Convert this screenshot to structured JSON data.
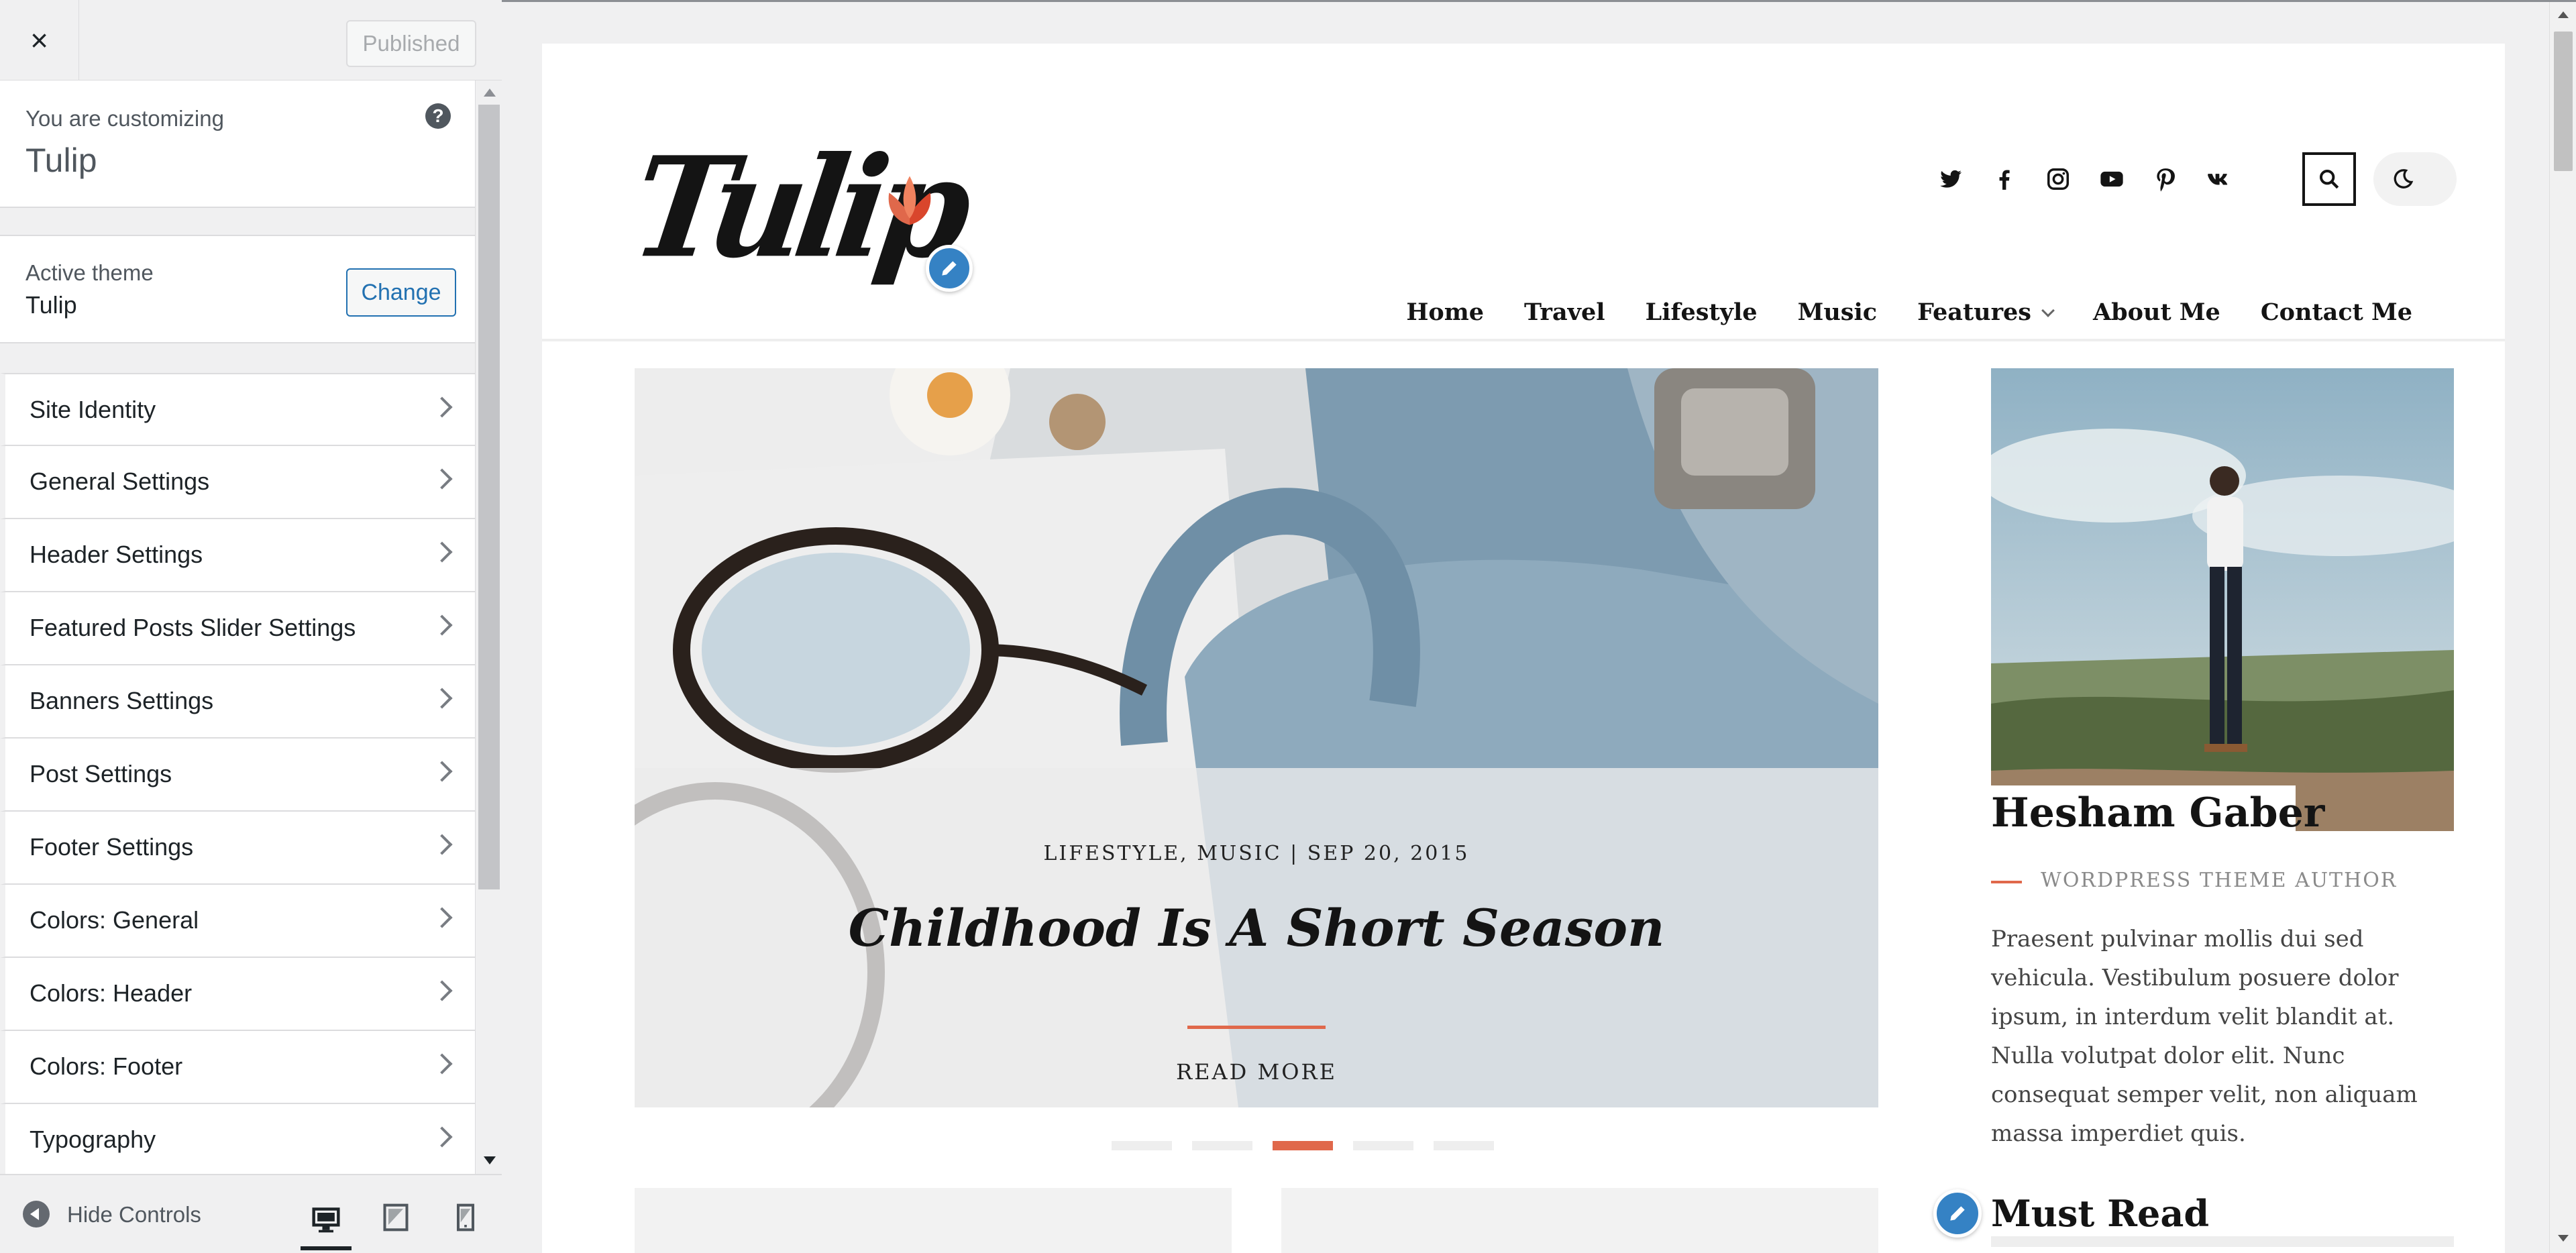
{
  "customizer": {
    "close_label": "×",
    "publish_label": "Published",
    "info_pre": "You are customizing",
    "info_name": "Tulip",
    "help_label": "?",
    "theme_pre": "Active theme",
    "theme_name": "Tulip",
    "change_label": "Change",
    "sections": [
      {
        "label": "Site Identity"
      },
      {
        "label": "General Settings"
      },
      {
        "label": "Header Settings"
      },
      {
        "label": "Featured Posts Slider Settings"
      },
      {
        "label": "Banners Settings"
      },
      {
        "label": "Post Settings"
      },
      {
        "label": "Footer Settings"
      },
      {
        "label": "Colors: General"
      },
      {
        "label": "Colors: Header"
      },
      {
        "label": "Colors: Footer"
      },
      {
        "label": "Typography"
      }
    ],
    "hide_controls_label": "Hide Controls",
    "devices": [
      "desktop-icon",
      "tablet-icon",
      "mobile-icon"
    ]
  },
  "site": {
    "logo_text": "Tulip",
    "social_icons": [
      "twitter-icon",
      "facebook-icon",
      "instagram-icon",
      "youtube-icon",
      "pinterest-icon",
      "vk-icon"
    ],
    "nav": [
      {
        "label": "Home"
      },
      {
        "label": "Travel"
      },
      {
        "label": "Lifestyle"
      },
      {
        "label": "Music"
      },
      {
        "label": "Features",
        "has_submenu": true
      },
      {
        "label": "About Me"
      },
      {
        "label": "Contact Me"
      }
    ],
    "slide": {
      "meta": "LIFESTYLE, MUSIC | SEP 20, 2015",
      "title": "Childhood Is A Short Season",
      "read_more": "READ MORE",
      "slide_count": 5,
      "active_index": 2
    },
    "author": {
      "name": "Hesham Gaber",
      "role": "WORDPRESS THEME AUTHOR",
      "bio": "Praesent pulvinar mollis dui sed vehicula. Vestibulum posuere dolor ipsum, in interdum velit blandit at. Nulla volutpat dolor elit. Nunc consequat semper velit, non aliquam massa imperdiet quis."
    },
    "must_read_title": "Must Read"
  },
  "colors": {
    "accent": "#e0684b",
    "wp_blue": "#2271b1",
    "pencil_blue": "#3582c4"
  }
}
